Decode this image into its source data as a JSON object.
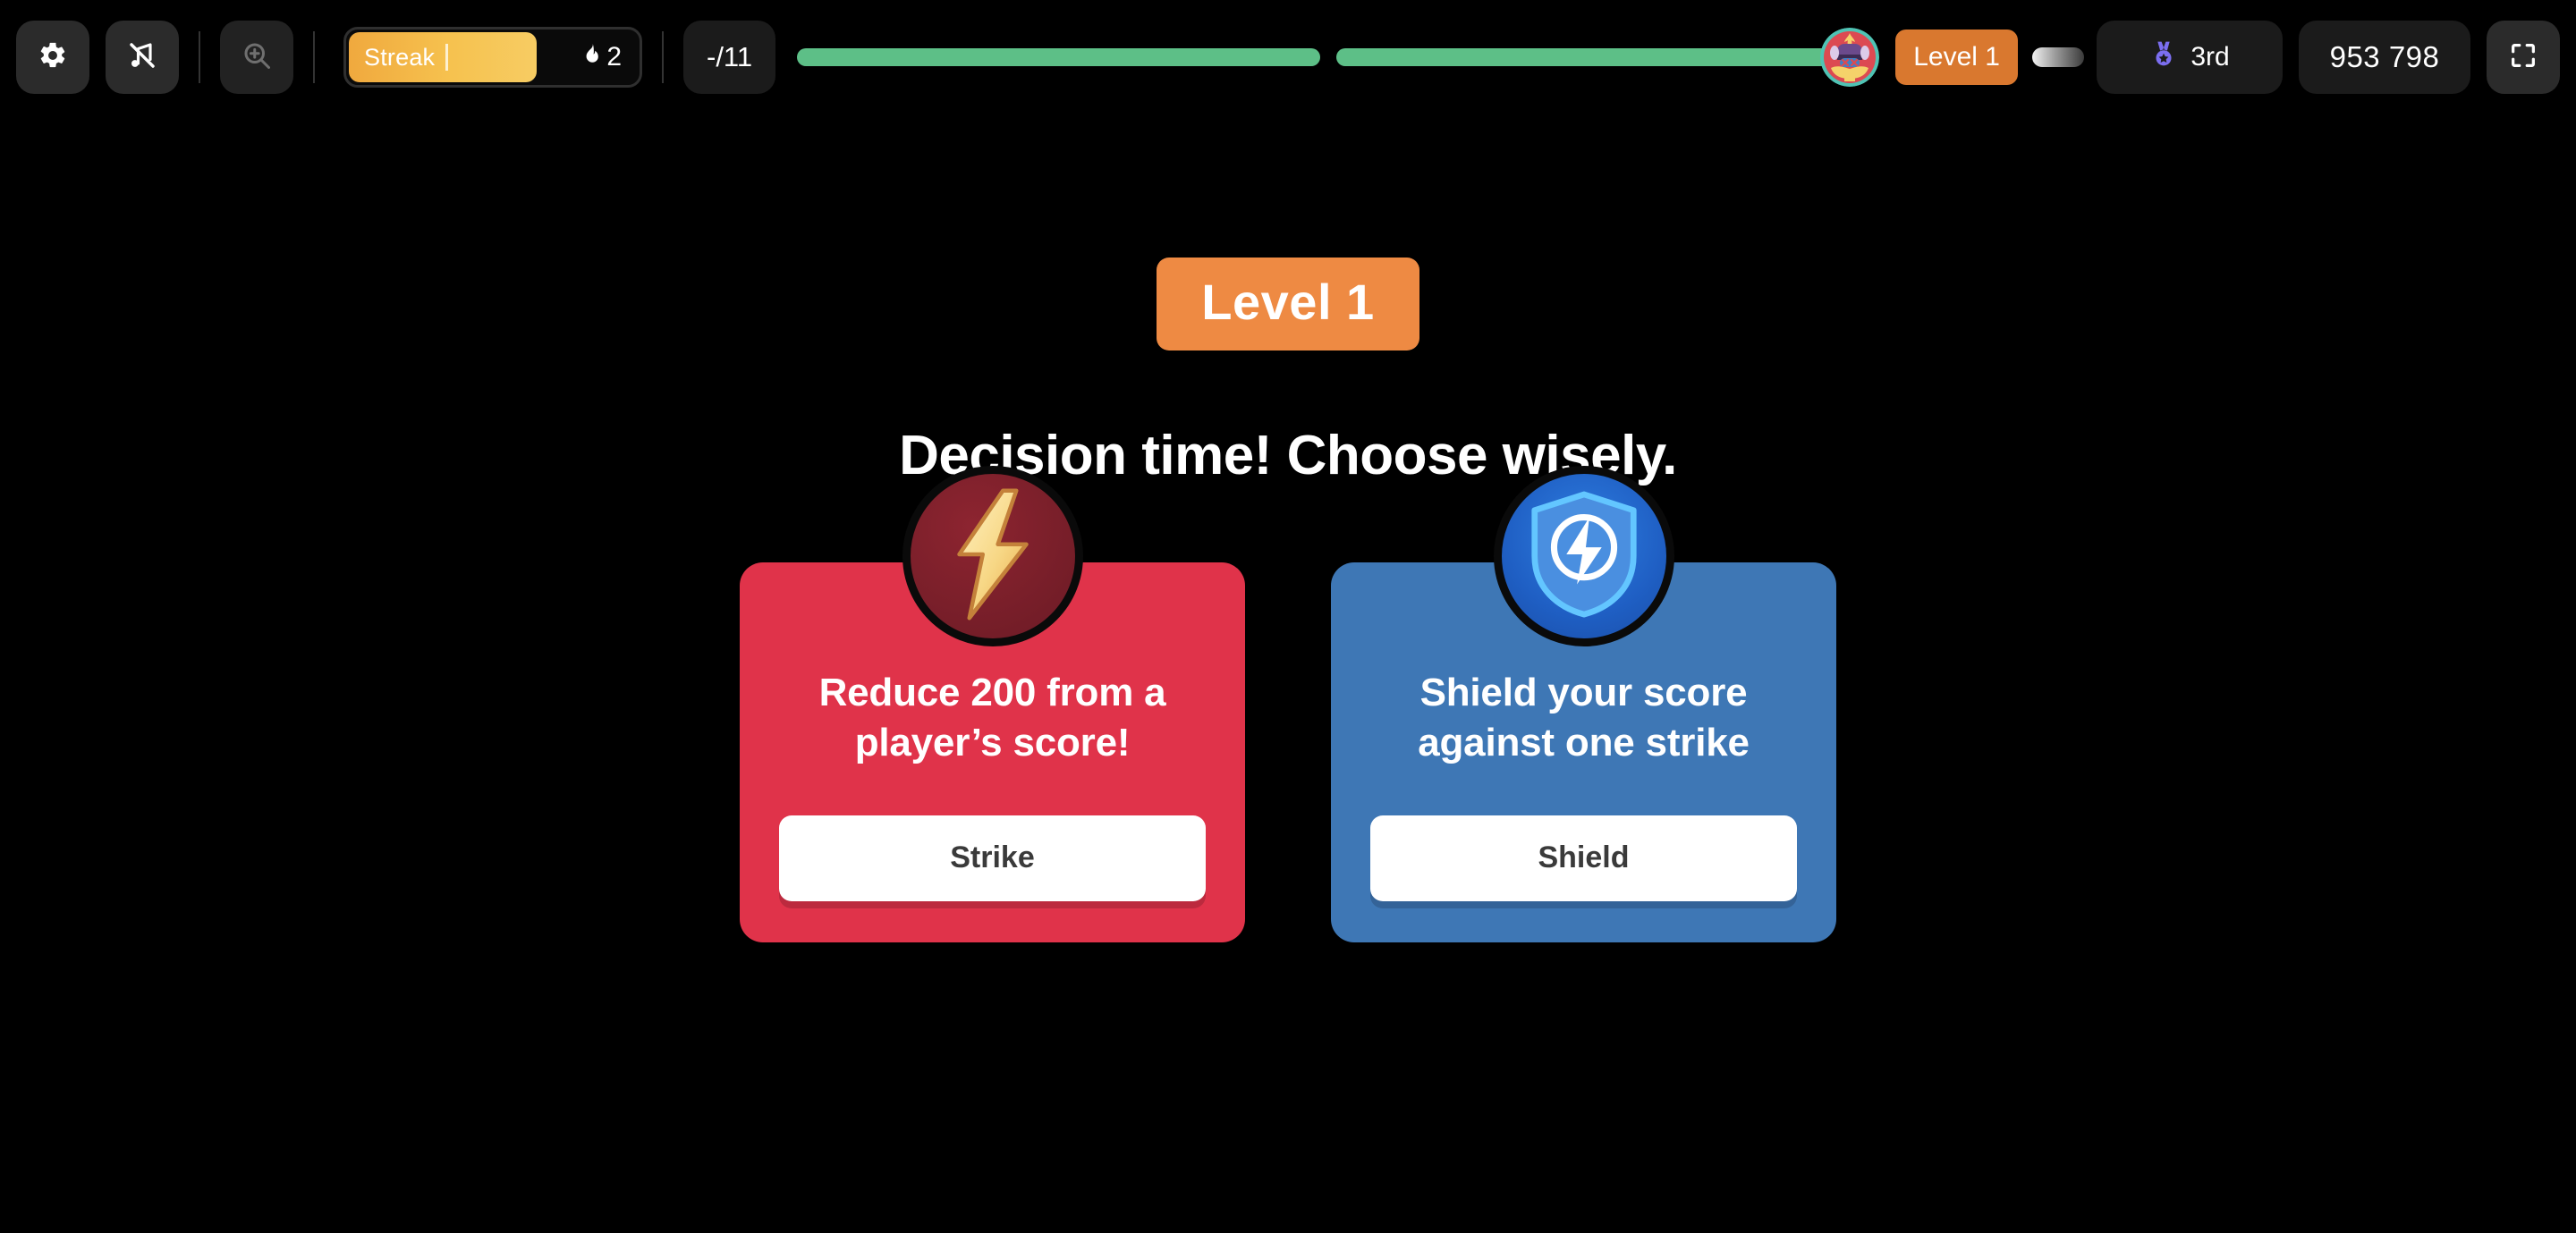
{
  "toolbar": {
    "settings_icon": "gear-icon",
    "sound_icon": "music-off-icon",
    "zoom_icon": "zoom-in-icon",
    "streak": {
      "label": "Streak",
      "count": "2",
      "flame_icon": "flame-icon",
      "fill_percent": 64
    },
    "question_counter": "-/11",
    "progress": {
      "segments": [
        100,
        100
      ]
    },
    "avatar_name": "player-avatar",
    "level_chip": "Level 1",
    "rank": {
      "icon": "medal-icon",
      "label": "3rd"
    },
    "score": "953 798",
    "fullscreen_icon": "fullscreen-icon"
  },
  "stage": {
    "level_banner": "Level 1",
    "headline": "Decision time! Choose wisely.",
    "cards": [
      {
        "key": "strike",
        "emblem_icon": "lightning-bolt-icon",
        "description": "Reduce 200 from a player’s score!",
        "action_label": "Strike",
        "color": "#E0334A"
      },
      {
        "key": "shield",
        "emblem_icon": "shield-bolt-icon",
        "description": "Shield your score against one strike",
        "action_label": "Shield",
        "color": "#3E77B5"
      }
    ]
  },
  "colors": {
    "background": "#000000",
    "accent_orange": "#EE8A43",
    "strike_red": "#E0334A",
    "shield_blue": "#3E77B5",
    "progress_green": "#5DBF87",
    "streak_yellow": "#F6C24F",
    "rank_purple": "#7B6EF0"
  }
}
